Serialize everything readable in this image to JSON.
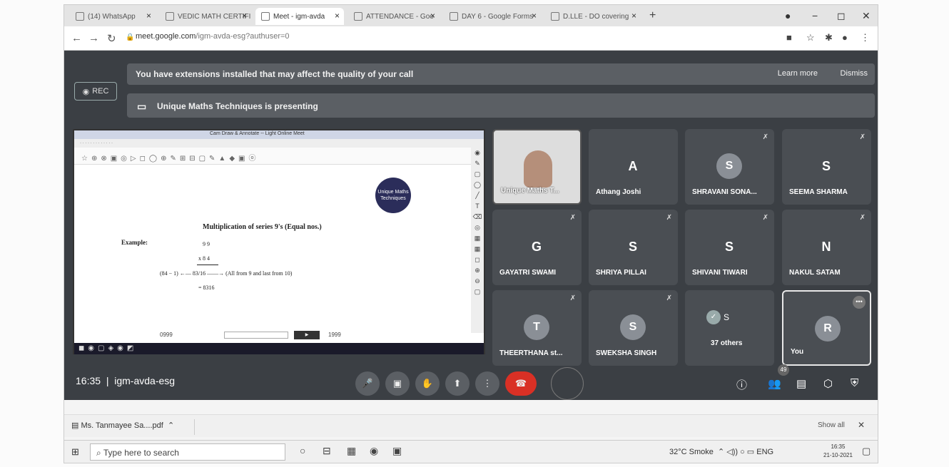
{
  "browser": {
    "tabs": [
      {
        "label": "(14) WhatsApp"
      },
      {
        "label": "VEDIC MATH CERTIFI"
      },
      {
        "label": "Meet - igm-avda"
      },
      {
        "label": "ATTENDANCE - Goo"
      },
      {
        "label": "DAY 6 - Google Forms"
      },
      {
        "label": "D.LLE - DO covering"
      }
    ],
    "url_host": "meet.google.com",
    "url_path": "/igm-avda-esg?authuser=0"
  },
  "banner": {
    "rec": "REC",
    "extension_msg": "You have extensions installed that may affect the quality of your call",
    "learn_more": "Learn more",
    "dismiss": "Dismiss",
    "presenting": "Unique Maths Techniques is presenting"
  },
  "slide": {
    "window_title": "Cam Draw & Annotate -- Light Online Meet",
    "logo_text": "Unique Maths Techniques",
    "heading": "Multiplication of series 9's (Equal nos.)",
    "example_label": "Example:",
    "lines": [
      "9 9",
      "x 8 4",
      "(84 − 1) ←— 83/16 ——→ (All from 9 and last from 10)",
      "= 8316"
    ],
    "page_left": "0999",
    "page_right": "1999"
  },
  "participants": [
    {
      "initial": "",
      "name": "Unique Maths T...",
      "video": true,
      "muted": false
    },
    {
      "initial": "A",
      "name": "Athang Joshi",
      "muted": false,
      "plain": true
    },
    {
      "initial": "S",
      "name": "SHRAVANI SONA...",
      "muted": true
    },
    {
      "initial": "S",
      "name": "SEEMA SHARMA",
      "muted": true,
      "plain": true
    },
    {
      "initial": "G",
      "name": "GAYATRI SWAMI",
      "muted": true,
      "plain": true
    },
    {
      "initial": "S",
      "name": "SHRIYA PILLAI",
      "muted": true,
      "plain": true
    },
    {
      "initial": "S",
      "name": "SHIVANI TIWARI",
      "muted": true,
      "plain": true
    },
    {
      "initial": "N",
      "name": "NAKUL SATAM",
      "muted": true,
      "plain": true
    },
    {
      "initial": "T",
      "name": "THEERTHANA st...",
      "muted": true
    },
    {
      "initial": "S",
      "name": "SWEKSHA SINGH",
      "muted": true
    },
    {
      "initial": "S",
      "name": "37 others",
      "others": true
    },
    {
      "initial": "R",
      "name": "You",
      "you": true
    }
  ],
  "controls": {
    "time": "16:35",
    "meeting_code": "igm-avda-esg",
    "people_count": "49"
  },
  "download": {
    "file": "Ms. Tanmayee Sa....pdf",
    "show_all": "Show all"
  },
  "taskbar": {
    "search_placeholder": "Type here to search",
    "weather": "32°C  Smoke",
    "lang": "ENG",
    "time": "16:35",
    "date": "21-10-2021"
  },
  "icons": {
    "mic": "microphone-icon",
    "cam": "camera-off-icon",
    "hand": "raise-hand-icon",
    "present": "present-icon",
    "more": "more-options-icon",
    "hangup": "hang-up-icon"
  }
}
